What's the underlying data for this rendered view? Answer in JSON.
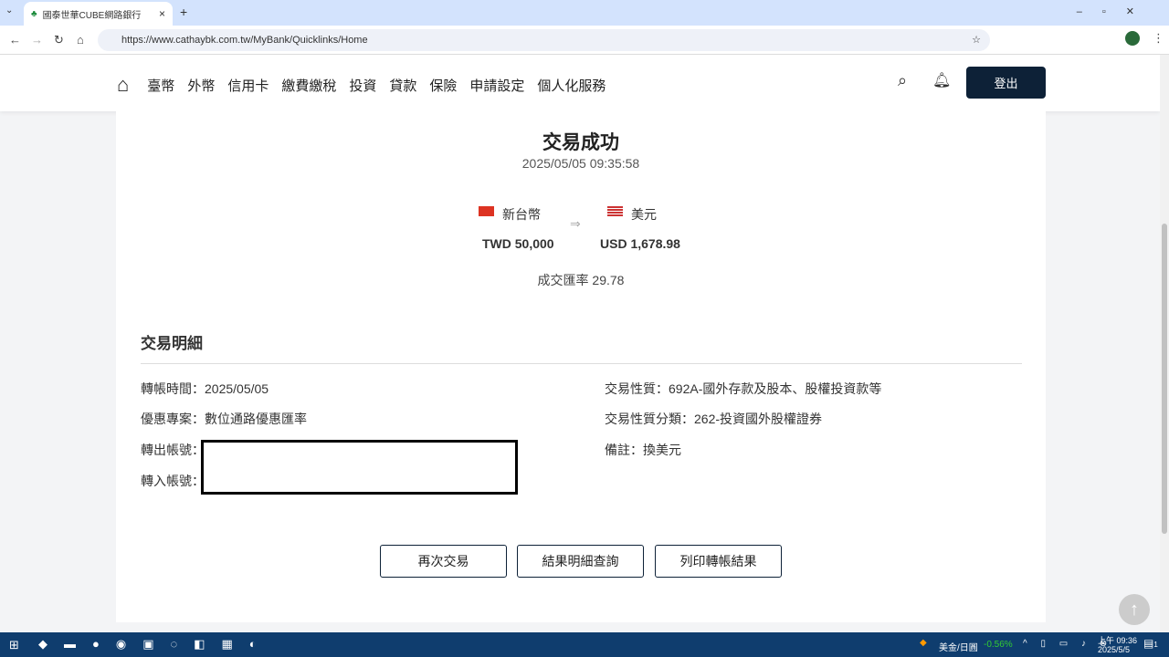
{
  "browser": {
    "tab_title": "國泰世華CUBE網路銀行",
    "url": "https://www.cathaybk.com.tw/MyBank/Quicklinks/Home"
  },
  "nav": {
    "items": [
      "臺幣",
      "外幣",
      "信用卡",
      "繳費繳稅",
      "投資",
      "貸款",
      "保險",
      "申請設定",
      "個人化服務"
    ],
    "login": "登出"
  },
  "result": {
    "title": "交易成功",
    "timestamp": "2025/05/05 09:35:58",
    "from_currency": "新台幣",
    "to_currency": "美元",
    "from_amount": "TWD 50,000",
    "to_amount": "USD 1,678.98",
    "rate": "成交匯率 29.78"
  },
  "details": {
    "heading": "交易明細",
    "transfer_time": "轉帳時間：2025/05/05",
    "promotion": "優惠專案：數位通路優惠匯率",
    "from_account": "轉出帳號：",
    "to_account": "轉入帳號：",
    "nature": "交易性質：692A-國外存款及股本、股權投資款等",
    "nature_category": "交易性質分類：262-投資國外股權證券",
    "note": "備註：換美元"
  },
  "actions": [
    "再次交易",
    "結果明細查詢",
    "列印轉帳結果"
  ],
  "taskbar": {
    "ticker": "美金/日圓",
    "change": "-0.56%",
    "time": "上午 09:36",
    "date": "2025/5/5",
    "notif": "1"
  }
}
